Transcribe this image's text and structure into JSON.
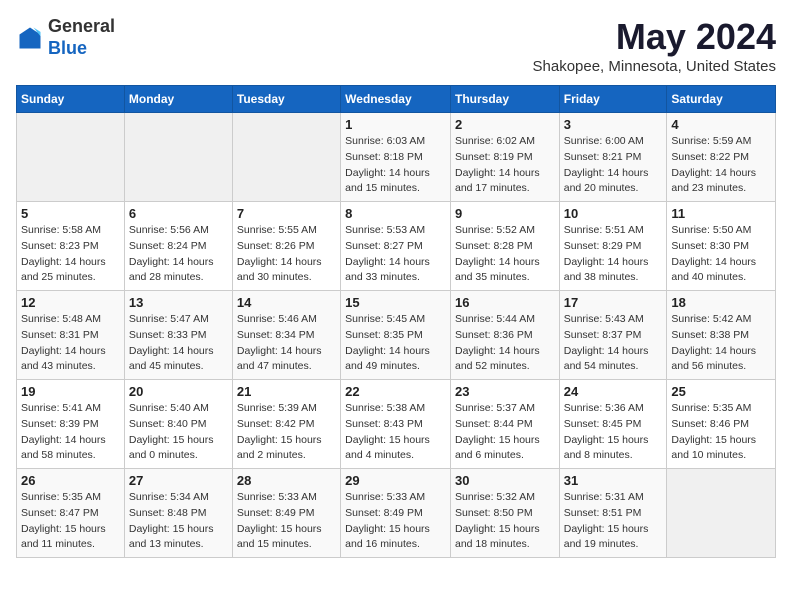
{
  "header": {
    "logo_general": "General",
    "logo_blue": "Blue",
    "month": "May 2024",
    "location": "Shakopee, Minnesota, United States"
  },
  "weekdays": [
    "Sunday",
    "Monday",
    "Tuesday",
    "Wednesday",
    "Thursday",
    "Friday",
    "Saturday"
  ],
  "weeks": [
    [
      {
        "day": "",
        "info": ""
      },
      {
        "day": "",
        "info": ""
      },
      {
        "day": "",
        "info": ""
      },
      {
        "day": "1",
        "info": "Sunrise: 6:03 AM\nSunset: 8:18 PM\nDaylight: 14 hours\nand 15 minutes."
      },
      {
        "day": "2",
        "info": "Sunrise: 6:02 AM\nSunset: 8:19 PM\nDaylight: 14 hours\nand 17 minutes."
      },
      {
        "day": "3",
        "info": "Sunrise: 6:00 AM\nSunset: 8:21 PM\nDaylight: 14 hours\nand 20 minutes."
      },
      {
        "day": "4",
        "info": "Sunrise: 5:59 AM\nSunset: 8:22 PM\nDaylight: 14 hours\nand 23 minutes."
      }
    ],
    [
      {
        "day": "5",
        "info": "Sunrise: 5:58 AM\nSunset: 8:23 PM\nDaylight: 14 hours\nand 25 minutes."
      },
      {
        "day": "6",
        "info": "Sunrise: 5:56 AM\nSunset: 8:24 PM\nDaylight: 14 hours\nand 28 minutes."
      },
      {
        "day": "7",
        "info": "Sunrise: 5:55 AM\nSunset: 8:26 PM\nDaylight: 14 hours\nand 30 minutes."
      },
      {
        "day": "8",
        "info": "Sunrise: 5:53 AM\nSunset: 8:27 PM\nDaylight: 14 hours\nand 33 minutes."
      },
      {
        "day": "9",
        "info": "Sunrise: 5:52 AM\nSunset: 8:28 PM\nDaylight: 14 hours\nand 35 minutes."
      },
      {
        "day": "10",
        "info": "Sunrise: 5:51 AM\nSunset: 8:29 PM\nDaylight: 14 hours\nand 38 minutes."
      },
      {
        "day": "11",
        "info": "Sunrise: 5:50 AM\nSunset: 8:30 PM\nDaylight: 14 hours\nand 40 minutes."
      }
    ],
    [
      {
        "day": "12",
        "info": "Sunrise: 5:48 AM\nSunset: 8:31 PM\nDaylight: 14 hours\nand 43 minutes."
      },
      {
        "day": "13",
        "info": "Sunrise: 5:47 AM\nSunset: 8:33 PM\nDaylight: 14 hours\nand 45 minutes."
      },
      {
        "day": "14",
        "info": "Sunrise: 5:46 AM\nSunset: 8:34 PM\nDaylight: 14 hours\nand 47 minutes."
      },
      {
        "day": "15",
        "info": "Sunrise: 5:45 AM\nSunset: 8:35 PM\nDaylight: 14 hours\nand 49 minutes."
      },
      {
        "day": "16",
        "info": "Sunrise: 5:44 AM\nSunset: 8:36 PM\nDaylight: 14 hours\nand 52 minutes."
      },
      {
        "day": "17",
        "info": "Sunrise: 5:43 AM\nSunset: 8:37 PM\nDaylight: 14 hours\nand 54 minutes."
      },
      {
        "day": "18",
        "info": "Sunrise: 5:42 AM\nSunset: 8:38 PM\nDaylight: 14 hours\nand 56 minutes."
      }
    ],
    [
      {
        "day": "19",
        "info": "Sunrise: 5:41 AM\nSunset: 8:39 PM\nDaylight: 14 hours\nand 58 minutes."
      },
      {
        "day": "20",
        "info": "Sunrise: 5:40 AM\nSunset: 8:40 PM\nDaylight: 15 hours\nand 0 minutes."
      },
      {
        "day": "21",
        "info": "Sunrise: 5:39 AM\nSunset: 8:42 PM\nDaylight: 15 hours\nand 2 minutes."
      },
      {
        "day": "22",
        "info": "Sunrise: 5:38 AM\nSunset: 8:43 PM\nDaylight: 15 hours\nand 4 minutes."
      },
      {
        "day": "23",
        "info": "Sunrise: 5:37 AM\nSunset: 8:44 PM\nDaylight: 15 hours\nand 6 minutes."
      },
      {
        "day": "24",
        "info": "Sunrise: 5:36 AM\nSunset: 8:45 PM\nDaylight: 15 hours\nand 8 minutes."
      },
      {
        "day": "25",
        "info": "Sunrise: 5:35 AM\nSunset: 8:46 PM\nDaylight: 15 hours\nand 10 minutes."
      }
    ],
    [
      {
        "day": "26",
        "info": "Sunrise: 5:35 AM\nSunset: 8:47 PM\nDaylight: 15 hours\nand 11 minutes."
      },
      {
        "day": "27",
        "info": "Sunrise: 5:34 AM\nSunset: 8:48 PM\nDaylight: 15 hours\nand 13 minutes."
      },
      {
        "day": "28",
        "info": "Sunrise: 5:33 AM\nSunset: 8:49 PM\nDaylight: 15 hours\nand 15 minutes."
      },
      {
        "day": "29",
        "info": "Sunrise: 5:33 AM\nSunset: 8:49 PM\nDaylight: 15 hours\nand 16 minutes."
      },
      {
        "day": "30",
        "info": "Sunrise: 5:32 AM\nSunset: 8:50 PM\nDaylight: 15 hours\nand 18 minutes."
      },
      {
        "day": "31",
        "info": "Sunrise: 5:31 AM\nSunset: 8:51 PM\nDaylight: 15 hours\nand 19 minutes."
      },
      {
        "day": "",
        "info": ""
      }
    ]
  ]
}
